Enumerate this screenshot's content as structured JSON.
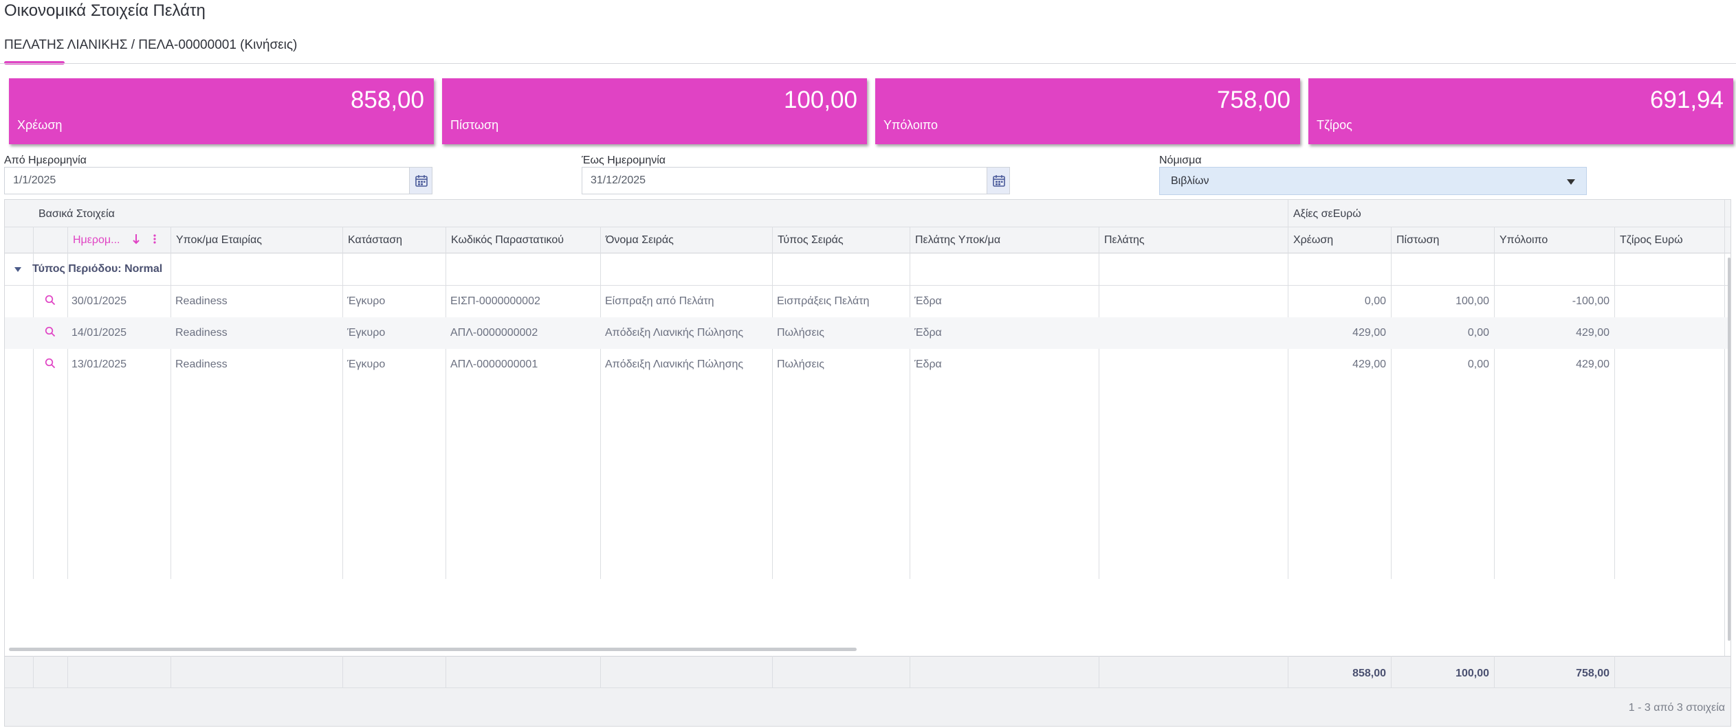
{
  "page": {
    "title": "Οικονομικά Στοιχεία Πελάτη",
    "tab_label": "ΠΕΛΑΤΗΣ ΛΙΑΝΙΚΗΣ / ΠΕΛΑ-00000001 (Κινήσεις)"
  },
  "kpis": [
    {
      "value": "858,00",
      "label": "Χρέωση"
    },
    {
      "value": "100,00",
      "label": "Πίστωση"
    },
    {
      "value": "758,00",
      "label": "Υπόλοιπο"
    },
    {
      "value": "691,94",
      "label": "Τζίρος"
    }
  ],
  "filters": {
    "from_label": "Από Ημερομηνία",
    "from_value": "1/1/2025",
    "to_label": "Έως Ημερομηνία",
    "to_value": "31/12/2025",
    "currency_label": "Νόμισμα",
    "currency_value": "Βιβλίων"
  },
  "grid": {
    "group_headers": [
      "Βασικά Στοιχεία",
      "Αξίες σεΕυρώ"
    ],
    "columns": [
      "Ημερομ...",
      "Υποκ/μα Εταιρίας",
      "Κατάσταση",
      "Κωδικός Παραστατικού",
      "Όνομα Σειράς",
      "Τύπος Σειράς",
      "Πελάτης Υποκ/μα",
      "Πελάτης",
      "Χρέωση",
      "Πίστωση",
      "Υπόλοιπο",
      "Τζίρος Ευρώ"
    ],
    "group_row": "Τύπος Περιόδου: Normal",
    "rows": [
      {
        "date": "30/01/2025",
        "branch": "Readiness",
        "status": "Έγκυρο",
        "code": "ΕΙΣΠ-0000000002",
        "series": "Είσπραξη από Πελάτη",
        "series_type": "Εισπράξεις Πελάτη",
        "cust_branch": "Έδρα",
        "customer": "",
        "debit": "0,00",
        "credit": "100,00",
        "balance": "-100,00",
        "turnover": ""
      },
      {
        "date": "14/01/2025",
        "branch": "Readiness",
        "status": "Έγκυρο",
        "code": "ΑΠΛ-0000000002",
        "series": "Απόδειξη Λιανικής Πώλησης",
        "series_type": "Πωλήσεις",
        "cust_branch": "Έδρα",
        "customer": "",
        "debit": "429,00",
        "credit": "0,00",
        "balance": "429,00",
        "turnover": ""
      },
      {
        "date": "13/01/2025",
        "branch": "Readiness",
        "status": "Έγκυρο",
        "code": "ΑΠΛ-0000000001",
        "series": "Απόδειξη Λιανικής Πώλησης",
        "series_type": "Πωλήσεις",
        "cust_branch": "Έδρα",
        "customer": "",
        "debit": "429,00",
        "credit": "0,00",
        "balance": "429,00",
        "turnover": ""
      }
    ],
    "totals": {
      "debit": "858,00",
      "credit": "100,00",
      "balance": "758,00"
    },
    "pager_text": "1 - 3 από 3 στοιχεία"
  },
  "colors": {
    "accent": "#e043c4",
    "select_bg": "#deeaf8",
    "header_bg": "#f3f4f6"
  }
}
